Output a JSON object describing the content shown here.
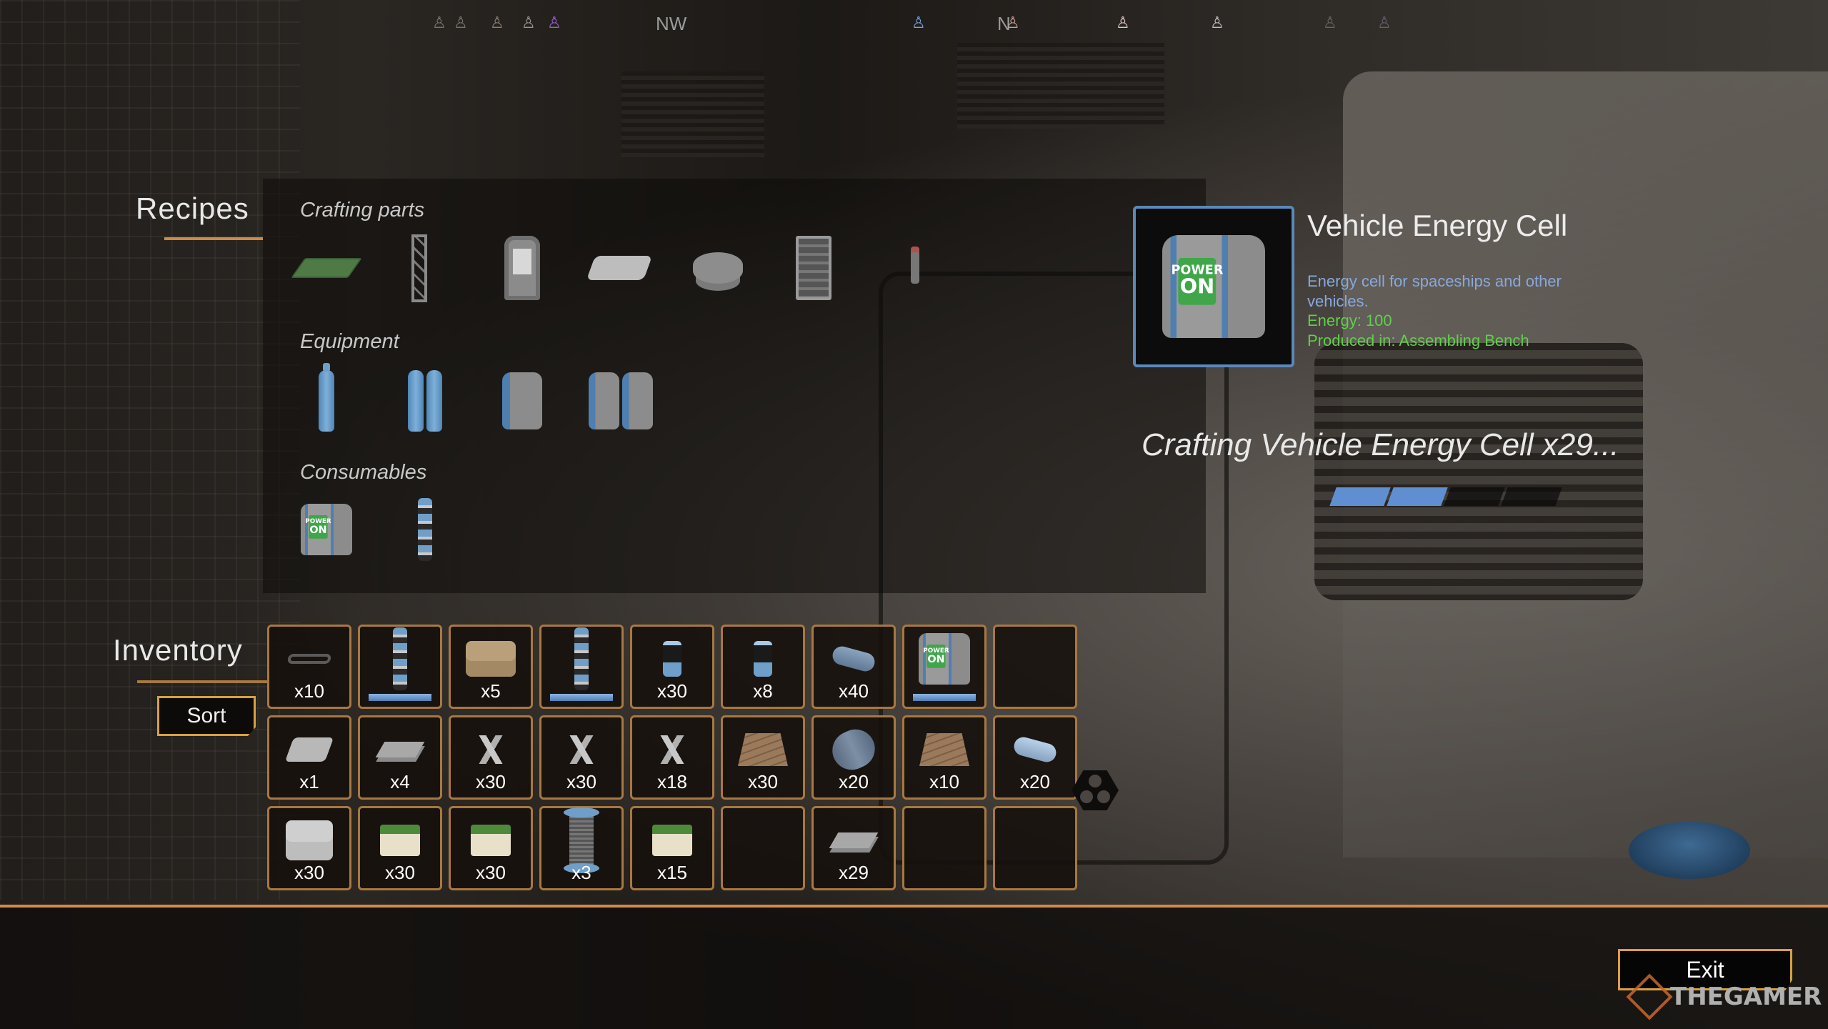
{
  "compass": {
    "directions": [
      {
        "label": "NW"
      },
      {
        "label": "N"
      }
    ],
    "markers": [
      {
        "name": "landmark-marker",
        "color": "#7a7470"
      },
      {
        "name": "landmark-marker",
        "color": "#7a7470"
      },
      {
        "name": "landmark-marker",
        "color": "#8a8070"
      },
      {
        "name": "landmark-marker",
        "color": "#9a9890"
      },
      {
        "name": "landmark-marker-highlight",
        "color": "#9a5ed0"
      },
      {
        "name": "landmark-marker",
        "color": "#7aa0d8"
      },
      {
        "name": "landmark-marker",
        "color": "#c8a090"
      },
      {
        "name": "landmark-marker",
        "color": "#e0c8c8"
      },
      {
        "name": "landmark-marker",
        "color": "#c0c0c0"
      },
      {
        "name": "landmark-marker",
        "color": "#6a6460"
      },
      {
        "name": "landmark-marker",
        "color": "#606070"
      }
    ]
  },
  "recipes": {
    "title": "Recipes",
    "categories": [
      {
        "title": "Crafting parts",
        "items": [
          {
            "icon": "circuit-board-icon"
          },
          {
            "icon": "truss-icon"
          },
          {
            "icon": "terminal-icon"
          },
          {
            "icon": "block-icon"
          },
          {
            "icon": "fan-icon"
          },
          {
            "icon": "rack-icon"
          },
          {
            "icon": "joystick-icon"
          }
        ]
      },
      {
        "title": "Equipment",
        "items": [
          {
            "icon": "oxygen-tank-icon"
          },
          {
            "icon": "double-oxygen-tank-icon"
          },
          {
            "icon": "battery-pack-icon"
          },
          {
            "icon": "double-battery-pack-icon"
          }
        ]
      },
      {
        "title": "Consumables",
        "items": [
          {
            "icon": "vehicle-energy-cell-icon"
          },
          {
            "icon": "energy-capsule-icon"
          }
        ]
      }
    ]
  },
  "detail": {
    "title": "Vehicle Energy Cell",
    "description": "Energy cell for spaceships and other vehicles.",
    "energy": "Energy: 100",
    "produced_in": "Produced in: Assembling Bench",
    "screen_top": "POWER",
    "screen_main": "ON",
    "frame_color": "#5b88bb"
  },
  "crafting": {
    "status": "Crafting Vehicle Energy Cell x29...",
    "progress_segments_total": 4,
    "progress_segments_filled": 2,
    "progress_color": "#5f8fd0"
  },
  "inventory": {
    "title": "Inventory",
    "sort_label": "Sort",
    "slots": [
      {
        "icon": "strap-icon",
        "qty": "x10"
      },
      {
        "icon": "energy-capsule-icon",
        "qty": "",
        "durability": 1.0
      },
      {
        "icon": "sandbags-icon",
        "qty": "x5"
      },
      {
        "icon": "energy-capsule-icon",
        "qty": "",
        "durability": 1.0
      },
      {
        "icon": "canister-icon",
        "qty": "x30"
      },
      {
        "icon": "canister-icon",
        "qty": "x8"
      },
      {
        "icon": "metal-rod-icon",
        "qty": "x40"
      },
      {
        "icon": "vehicle-energy-cell-icon",
        "qty": "",
        "durability": 1.0
      },
      {
        "icon": "",
        "qty": ""
      },
      {
        "icon": "ingot-icon",
        "qty": "x1"
      },
      {
        "icon": "metal-sheets-icon",
        "qty": "x4"
      },
      {
        "icon": "sticks-icon",
        "qty": "x30"
      },
      {
        "icon": "sticks-icon",
        "qty": "x30"
      },
      {
        "icon": "sticks-icon",
        "qty": "x18"
      },
      {
        "icon": "wood-planks-icon",
        "qty": "x30"
      },
      {
        "icon": "metal-cylinder-icon",
        "qty": "x20"
      },
      {
        "icon": "wood-planks-icon",
        "qty": "x10"
      },
      {
        "icon": "light-rod-icon",
        "qty": "x20"
      },
      {
        "icon": "bales-icon",
        "qty": "x30"
      },
      {
        "icon": "planter-icon",
        "qty": "x30"
      },
      {
        "icon": "planter-icon",
        "qty": "x30"
      },
      {
        "icon": "spool-icon",
        "qty": "x3"
      },
      {
        "icon": "planter-icon",
        "qty": "x15"
      },
      {
        "icon": "",
        "qty": ""
      },
      {
        "icon": "metal-sheets-icon",
        "qty": "x29"
      },
      {
        "icon": "",
        "qty": ""
      },
      {
        "icon": "",
        "qty": ""
      }
    ]
  },
  "footer": {
    "exit_label": "Exit",
    "watermark": "THEGAMER"
  },
  "colors": {
    "accent_orange": "#d48a48",
    "slot_border": "#a87840",
    "button_border": "#d9a040",
    "description_blue": "#88a8dc",
    "stat_green": "#5ed04a"
  }
}
